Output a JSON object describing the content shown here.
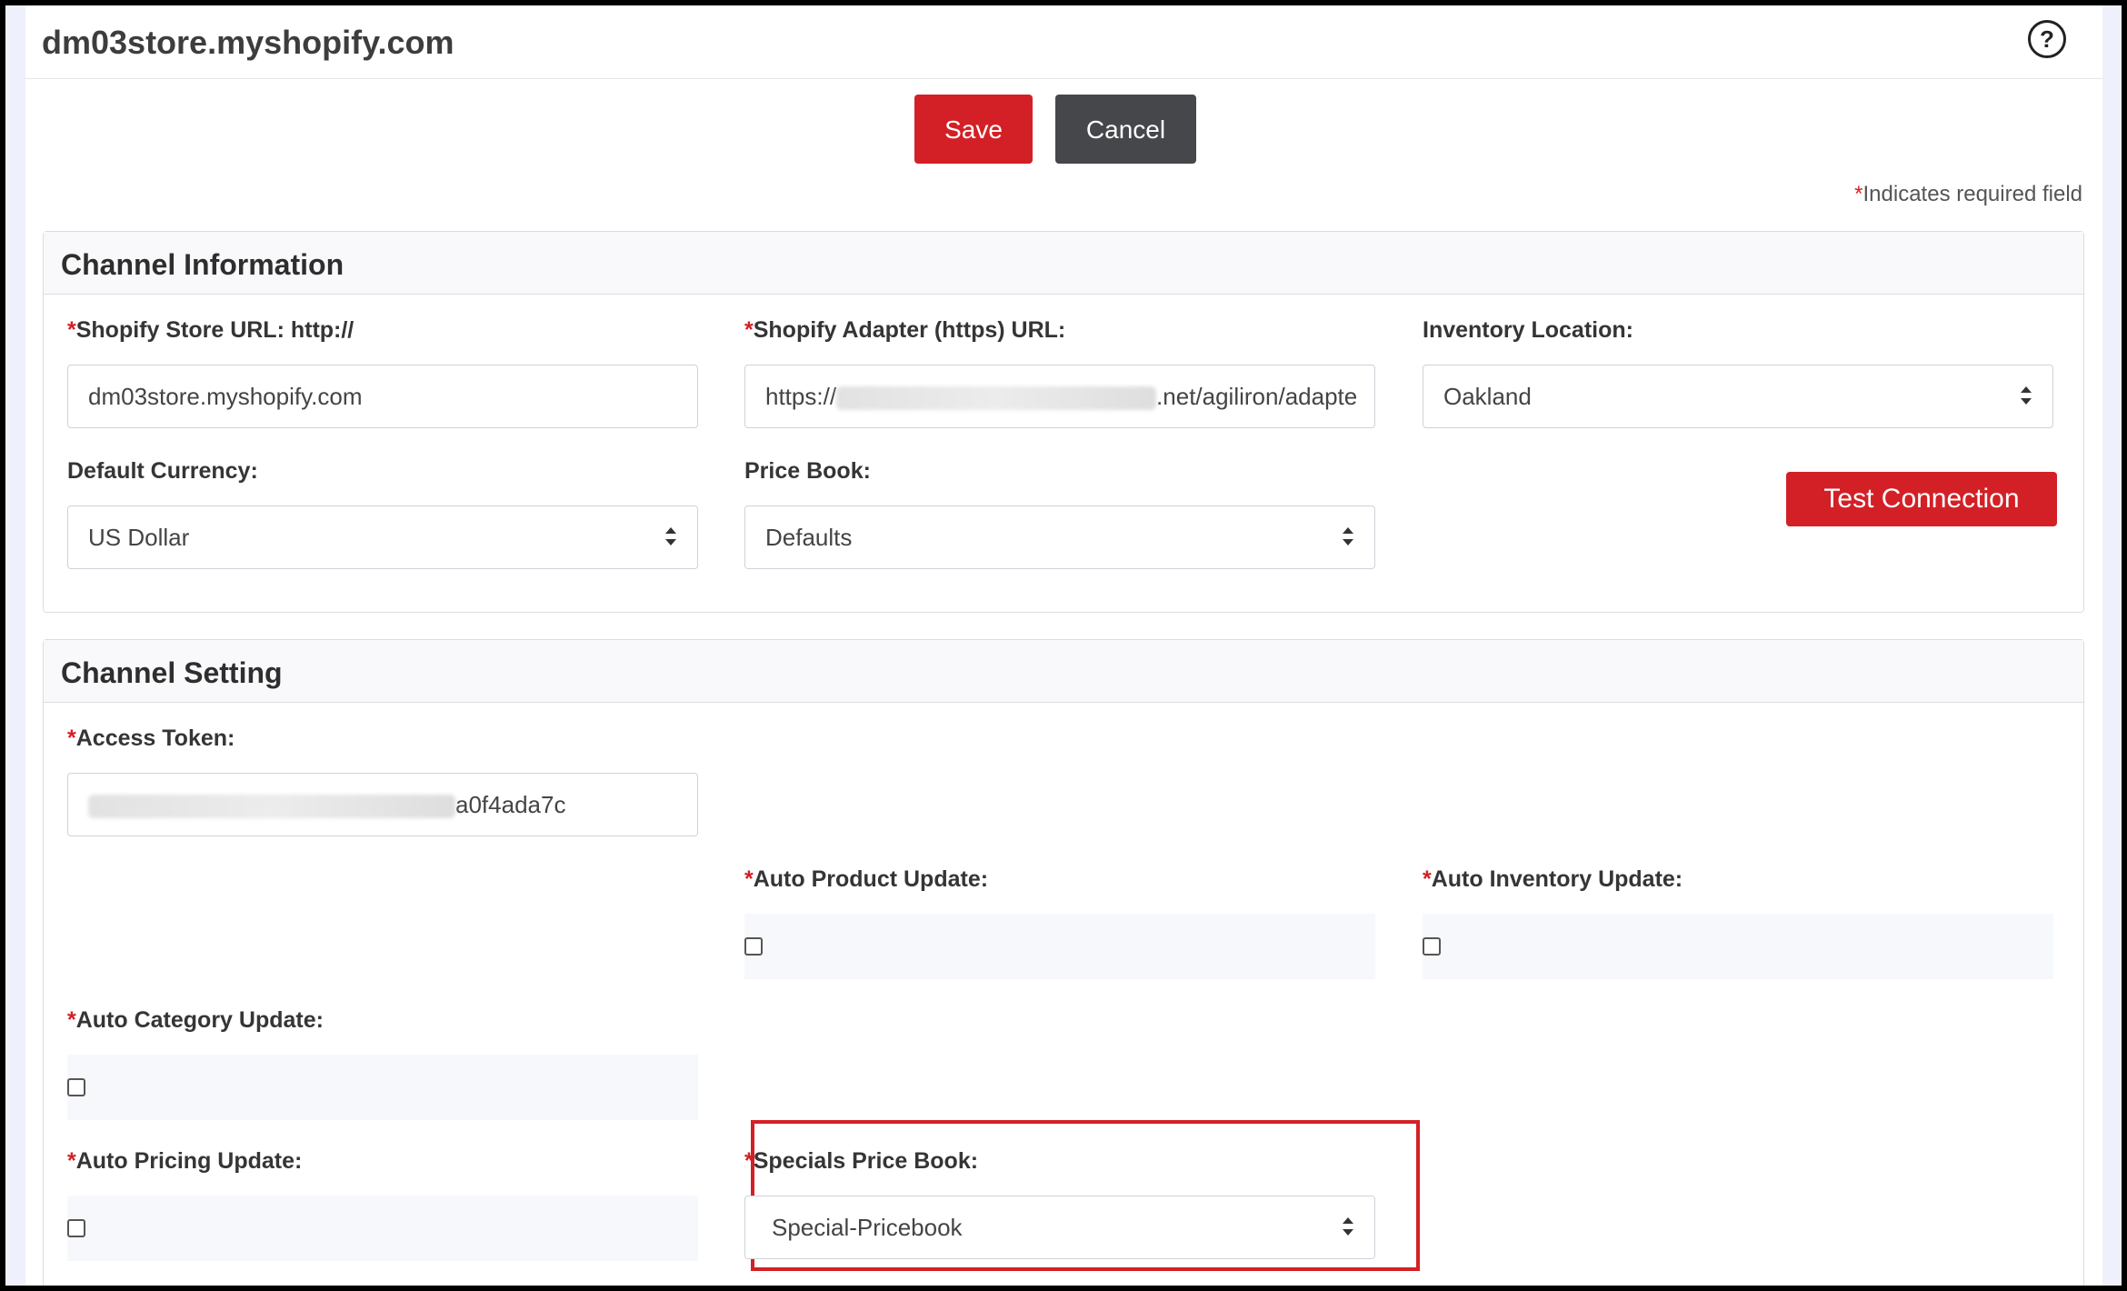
{
  "header": {
    "store_title": "dm03store.myshopify.com",
    "help_icon": "question-circle-icon"
  },
  "toolbar": {
    "save_label": "Save",
    "cancel_label": "Cancel"
  },
  "required_note": {
    "star": "*",
    "text": "Indicates required field"
  },
  "channel_information": {
    "title": "Channel Information",
    "store_url": {
      "label": "Shopify Store URL: http://",
      "value": "dm03store.myshopify.com"
    },
    "adapter_url": {
      "label": "Shopify Adapter (https) URL:",
      "value_prefix": "https://",
      "value_suffix": ".net/agiliron/adapte"
    },
    "inventory_location": {
      "label": "Inventory Location:",
      "value": "Oakland"
    },
    "default_currency": {
      "label": "Default Currency:",
      "value": "US Dollar"
    },
    "price_book": {
      "label": "Price Book:",
      "value": "Defaults"
    },
    "test_connection_label": "Test Connection"
  },
  "channel_setting": {
    "title": "Channel Setting",
    "access_token": {
      "label": "Access Token:",
      "value_suffix": "a0f4ada7c"
    },
    "auto_product_update": {
      "label": "Auto Product Update:",
      "checked": false
    },
    "auto_inventory_update": {
      "label": "Auto Inventory Update:",
      "checked": false
    },
    "auto_category_update": {
      "label": "Auto Category Update:",
      "checked": false
    },
    "auto_pricing_update": {
      "label": "Auto Pricing Update:",
      "checked": false
    },
    "specials_price_book": {
      "label": "Specials Price Book:",
      "value": "Special-Pricebook"
    }
  },
  "colors": {
    "accent": "#d32026",
    "cancel": "#46474b"
  }
}
